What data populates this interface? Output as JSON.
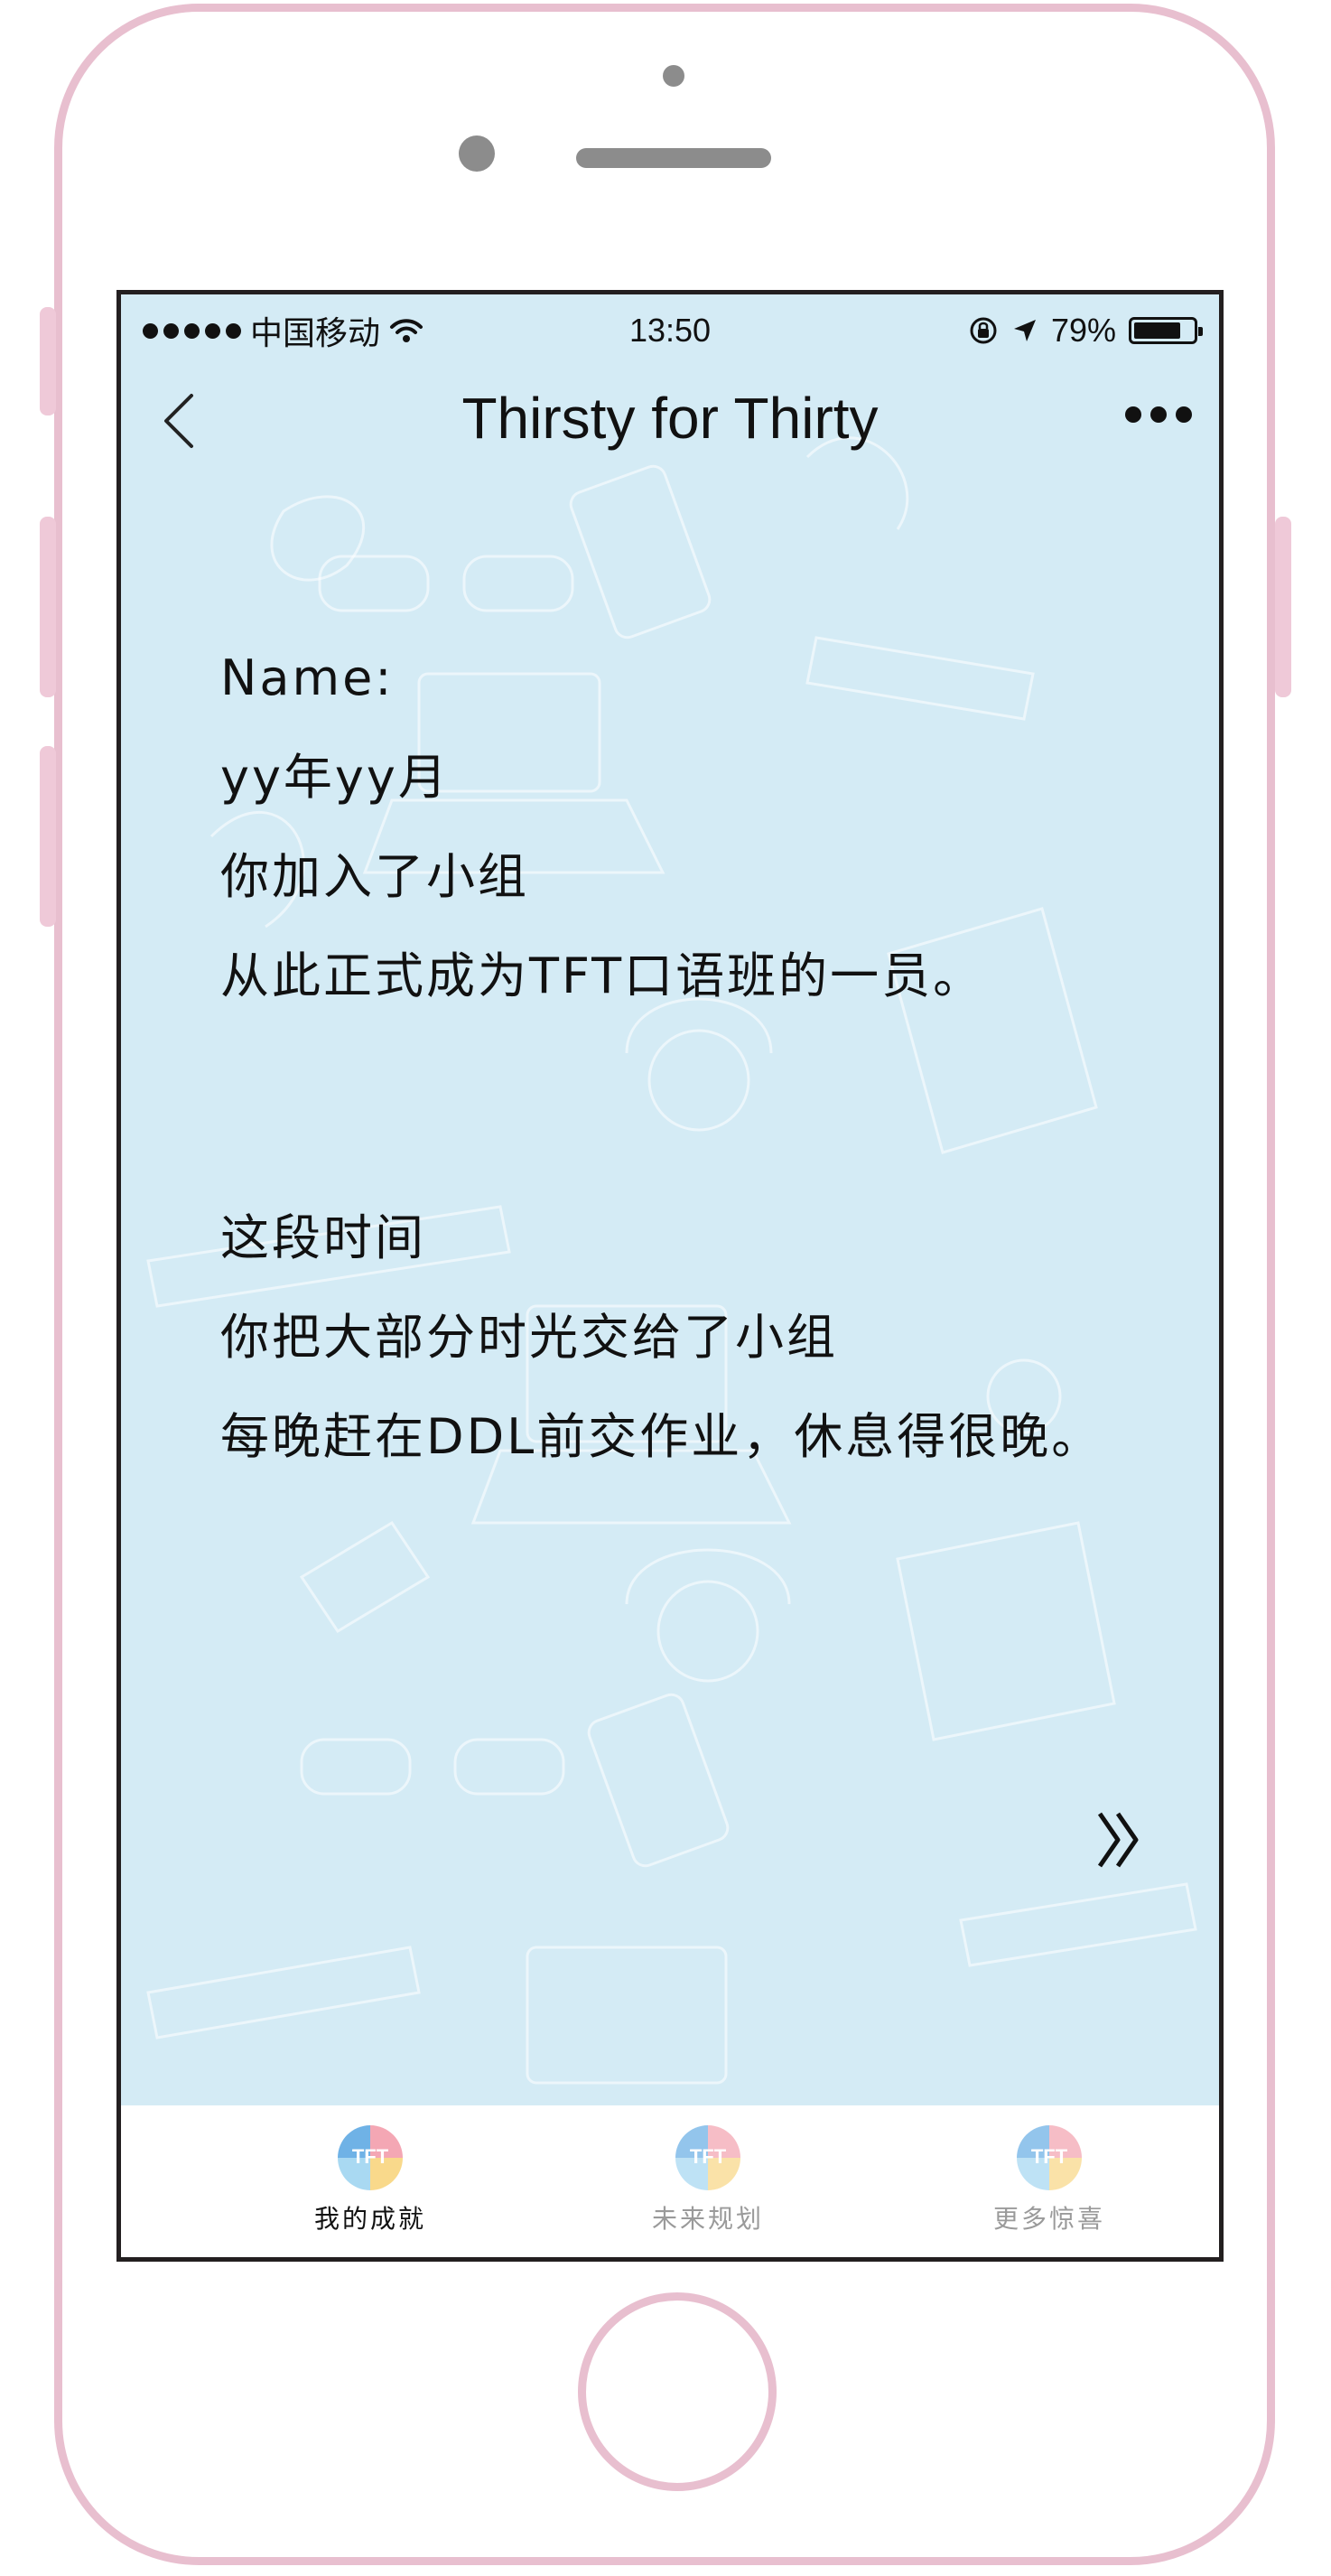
{
  "status_bar": {
    "carrier": "中国移动",
    "time": "13:50",
    "battery": "79%",
    "battery_level": 0.79
  },
  "nav": {
    "title": "Thirsty for Thirty"
  },
  "letter": {
    "paragraph1": [
      "Name:",
      "yy年yy月",
      "你加入了小组",
      "从此正式成为TFT口语班的一员。"
    ],
    "paragraph2": [
      "这段时间",
      "你把大部分时光交给了小组",
      "每晚赶在DDL前交作业，休息得很晚。"
    ]
  },
  "tabs": [
    {
      "label": "我的成就",
      "logo_text": "TFT",
      "active": true
    },
    {
      "label": "未来规划",
      "logo_text": "TFT",
      "active": false
    },
    {
      "label": "更多惊喜",
      "logo_text": "TFT",
      "active": false
    }
  ],
  "colors": {
    "screen_bg": "#d4ebf5",
    "phone_frame": "#e8bfcf",
    "text": "#111111",
    "tab_inactive": "#9a9a9a"
  }
}
